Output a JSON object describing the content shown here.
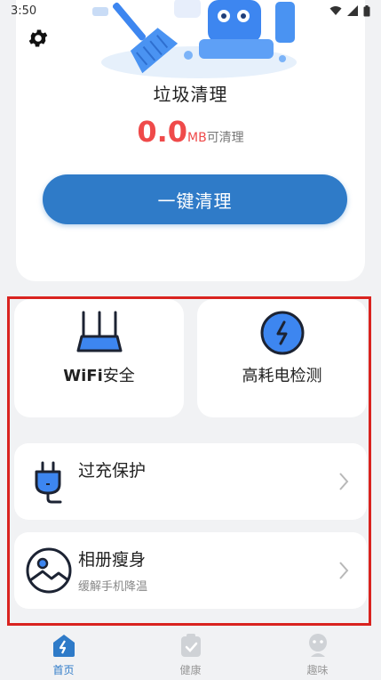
{
  "status_bar": {
    "time": "3:50"
  },
  "cleaner": {
    "title": "垃圾清理",
    "amount": "0.0",
    "unit": "MB",
    "suffix": "可清理",
    "button_label": "一键清理"
  },
  "tools": {
    "wifi": {
      "label_bold": "WiFi",
      "label_rest": "安全"
    },
    "power": {
      "label": "高耗电检测"
    },
    "charge": {
      "title": "过充保护"
    },
    "album": {
      "title": "相册瘦身",
      "subtitle": "缓解手机降温"
    }
  },
  "nav": {
    "items": [
      {
        "label": "首页",
        "icon": "home-bolt-icon",
        "active": true
      },
      {
        "label": "健康",
        "icon": "health-clipboard-icon",
        "active": false
      },
      {
        "label": "趣味",
        "icon": "fun-face-icon",
        "active": false
      }
    ]
  },
  "colors": {
    "accent": "#2f7bc8",
    "danger": "#ef4a4a",
    "icon_blue": "#3d86f0",
    "highlight": "#d9231f"
  }
}
